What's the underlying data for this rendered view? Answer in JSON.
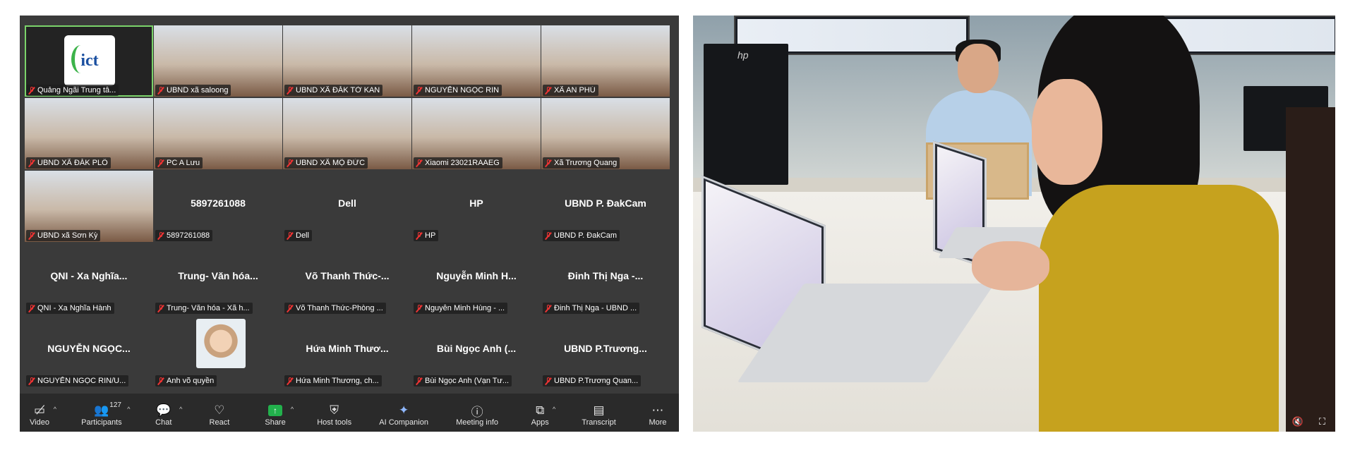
{
  "participants": [
    {
      "kind": "logo",
      "logo_text": "ict",
      "label": "Quảng Ngãi Trung tâ...",
      "active": true
    },
    {
      "kind": "video",
      "label": "UBND xã saloong"
    },
    {
      "kind": "video",
      "label": "UBND XÃ ĐĂK TỜ KAN"
    },
    {
      "kind": "video",
      "label": "NGUYỄN NGỌC RIN"
    },
    {
      "kind": "video",
      "label": "XÃ AN PHÚ"
    },
    {
      "kind": "video",
      "label": "UBND XÃ ĐĂK PLÔ"
    },
    {
      "kind": "video",
      "label": "PC A Lưu"
    },
    {
      "kind": "video",
      "label": "UBND XÃ MỘ ĐỨC"
    },
    {
      "kind": "video",
      "label": "Xiaomi 23021RAAEG"
    },
    {
      "kind": "video",
      "label": "Xã Trương Quang"
    },
    {
      "kind": "video",
      "label": "UBND xã Sơn Kỳ"
    },
    {
      "kind": "name",
      "display": "5897261088",
      "label": "5897261088"
    },
    {
      "kind": "name",
      "display": "Dell",
      "label": "Dell"
    },
    {
      "kind": "name",
      "display": "HP",
      "label": "HP"
    },
    {
      "kind": "name",
      "display": "UBND P. ĐakCam",
      "label": "UBND P. ĐakCam"
    },
    {
      "kind": "name",
      "display": "QNI - Xa Nghĩa...",
      "label": "QNI - Xa Nghĩa Hành"
    },
    {
      "kind": "name",
      "display": "Trung- Văn hóa...",
      "label": "Trung- Văn hóa - Xã h..."
    },
    {
      "kind": "name",
      "display": "Võ Thanh Thức-...",
      "label": "Võ Thanh Thức-Phòng ..."
    },
    {
      "kind": "name",
      "display": "Nguyễn Minh H...",
      "label": "Nguyễn Minh Hùng - ..."
    },
    {
      "kind": "name",
      "display": "Đinh Thị Nga -...",
      "label": "Đinh Thị Nga - UBND ..."
    },
    {
      "kind": "name",
      "display": "NGUYỄN NGỌC...",
      "label": "NGUYỄN NGỌC RIN/U..."
    },
    {
      "kind": "avatar",
      "label": "Anh võ quyền"
    },
    {
      "kind": "name",
      "display": "Hứa Minh Thươ...",
      "label": "Hứa Minh Thương, ch..."
    },
    {
      "kind": "name",
      "display": "Bùi Ngọc Anh (...",
      "label": "Bùi Ngọc Anh (Vạn Tư..."
    },
    {
      "kind": "name",
      "display": "UBND P.Trương...",
      "label": "UBND P.Trương Quan..."
    }
  ],
  "toolbar": {
    "video": "Video",
    "participants": "Participants",
    "participants_count": "127",
    "chat": "Chat",
    "react": "React",
    "share": "Share",
    "host_tools": "Host tools",
    "ai_companion": "AI Companion",
    "meeting_info": "Meeting info",
    "apps": "Apps",
    "transcript": "Transcript",
    "more": "More"
  },
  "colors": {
    "window_bg": "#3a3a3a",
    "toolbar_bg": "#2a2a2a",
    "active_speaker": "#7bd36a",
    "muted_mic": "#ee3333",
    "share_green": "#22b14c"
  },
  "photo": {
    "brand_logo": "hp"
  }
}
